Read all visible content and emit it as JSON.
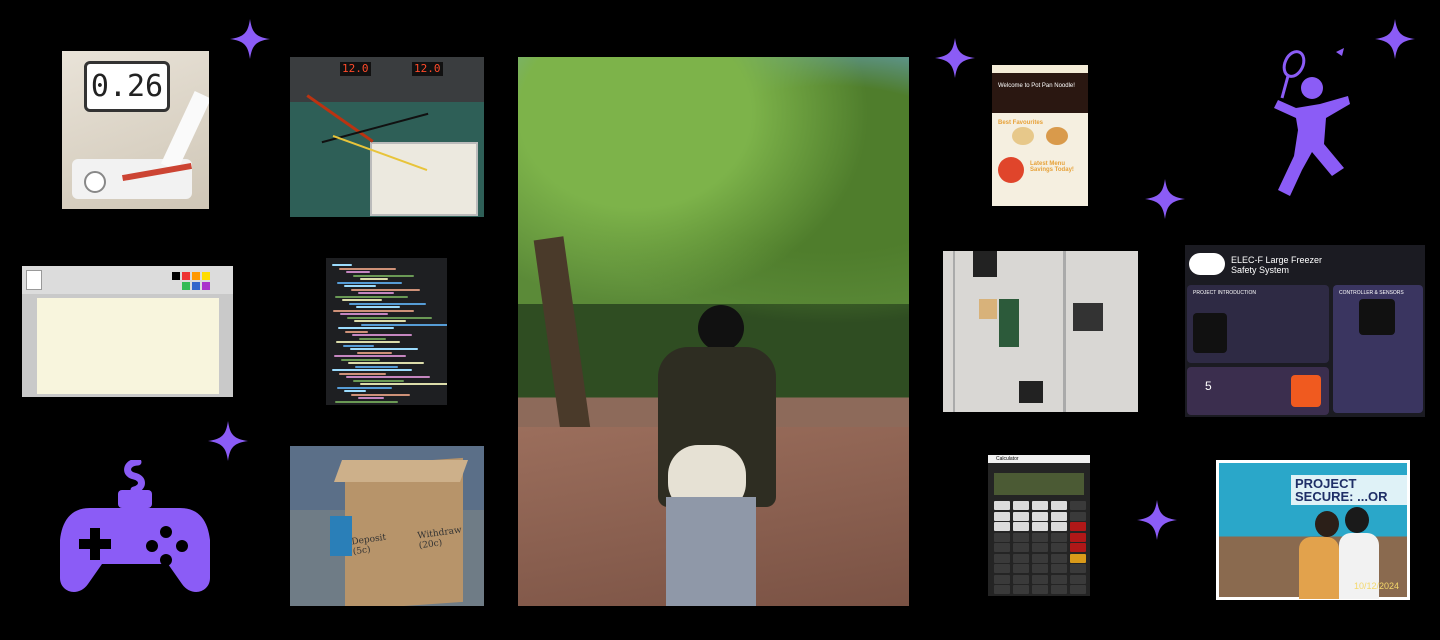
{
  "colors": {
    "background": "#000000",
    "accent_purple": "#8b5cf6",
    "sparkle": "#8b5cf6"
  },
  "icons": {
    "gamepad": "gamepad-icon",
    "badminton": "badminton-player-icon",
    "sparkle": "sparkle-icon"
  },
  "tiles": {
    "servo_display": {
      "reading": "0.26"
    },
    "power_supply": {
      "left_readout": "12.0",
      "right_readout": "12.0"
    },
    "box_project": {
      "label_left": "Deposit (5c)",
      "label_right": "Withdraw (20c)"
    },
    "website": {
      "hero_text": "Welcome to Pot Pan Noodle!",
      "section_text": "Best Favourites",
      "promo_text": "Latest Menu Savings Today!"
    },
    "poster": {
      "title": "ELEC-F Large Freezer Safety System",
      "section_left": "PROJECT INTRODUCTION",
      "section_right": "CONTROLLER & SENSORS",
      "counter": "5"
    },
    "calculator": {
      "title": "Calculator"
    },
    "event_photo": {
      "banner": "PROJECT SECURE: ...OR",
      "date": "10/12/2024"
    }
  }
}
